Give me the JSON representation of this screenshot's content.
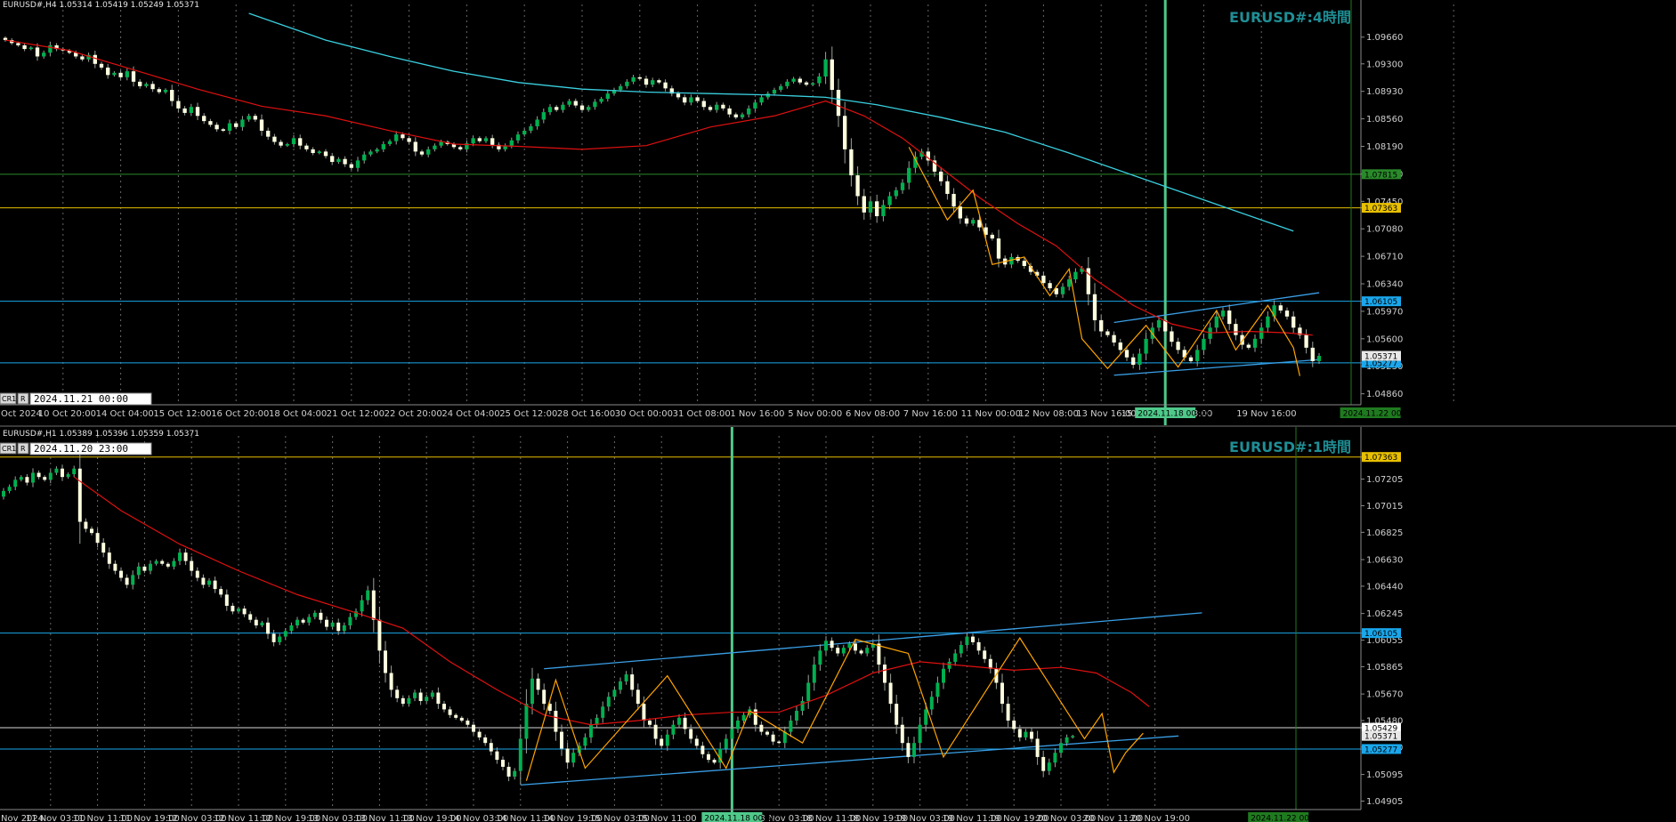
{
  "colors": {
    "bg": "#000000",
    "bull": "#00b050",
    "bear": "#ffffe0",
    "wick": "#9aa39a",
    "ma_fast": "#e01010",
    "ma_slow": "#3ad0e0",
    "zigzag": "#ffa500",
    "channel": "#3aa0e8",
    "hline_blue": "#1aa7ec",
    "hline_yellow": "#e8c000",
    "hline_green": "#2a8a2a",
    "hline_white": "#d8d8d8",
    "vline_green": "#4fc98a",
    "grid": "#bdbdbd",
    "watermark": "#1f8f96"
  },
  "chart_data": [
    {
      "type": "candlestick",
      "symbol_info": "EURUSD#,H4  1.05314 1.05419 1.05249 1.05371",
      "watermark": "EURUSD#:4時間",
      "cursor_date": "2024.11.21 00:00",
      "cursor_btn_cr": "CR1",
      "cursor_btn_r": "R",
      "ylim": [
        1.0476,
        1.0998
      ],
      "price_ticks": [
        "1.09660",
        "1.09300",
        "1.08930",
        "1.08560",
        "1.08190",
        "1.07820",
        "1.07450",
        "1.07080",
        "1.06710",
        "1.06340",
        "1.05970",
        "1.05600",
        "1.05230",
        "1.04860"
      ],
      "price_tick_values": [
        1.0966,
        1.093,
        1.0893,
        1.0856,
        1.0819,
        1.0782,
        1.0745,
        1.0708,
        1.0671,
        1.0634,
        1.0597,
        1.056,
        1.0523,
        1.0486
      ],
      "time_labels": [
        "Oct 2024",
        "10 Oct 20:00",
        "14 Oct 04:00",
        "15 Oct 12:00",
        "16 Oct 20:00",
        "18 Oct 04:00",
        "21 Oct 12:00",
        "22 Oct 20:00",
        "24 Oct 04:00",
        "25 Oct 12:00",
        "28 Oct 16:00",
        "30 Oct 00:00",
        "31 Oct 08:00",
        "1 Nov 16:00",
        "5 Nov 00:00",
        "6 Nov 08:00",
        "7 Nov 16:00",
        "11 Nov 00:00",
        "12 Nov 08:00",
        "13 Nov 16:00",
        "15",
        "v 08:00",
        "19 Nov 16:00"
      ],
      "time_label_bars": [
        0,
        9,
        18,
        27,
        36,
        45,
        54,
        63,
        72,
        81,
        90,
        99,
        108,
        117,
        126,
        135,
        144,
        153,
        162,
        171,
        178,
        187,
        196
      ],
      "time_marker_label": "2024.11.18 00:00",
      "time_marker_label_bar": 181,
      "future_time_label": "2024.11.22 00:00",
      "future_time_label_bar": 213,
      "hlines": [
        {
          "price": 1.07815,
          "label": "1.07815",
          "color": "hline_green"
        },
        {
          "price": 1.07363,
          "label": "1.07363",
          "color": "hline_yellow"
        },
        {
          "price": 1.06105,
          "label": "1.06105",
          "color": "hline_blue"
        },
        {
          "price": 1.05277,
          "label": "1.05277",
          "color": "hline_blue"
        }
      ],
      "current_price": 1.05371,
      "current_price_label": "1.05371",
      "vline_bar": 181,
      "future_vline_bar": 210,
      "channel_upper": [
        [
          173,
          1.0582
        ],
        [
          205,
          1.0622
        ]
      ],
      "channel_lower": [
        [
          173,
          1.0511
        ],
        [
          205,
          1.0532
        ]
      ],
      "ma_fast_points": [
        [
          0,
          1.0962
        ],
        [
          10,
          1.0948
        ],
        [
          20,
          1.0922
        ],
        [
          30,
          1.0896
        ],
        [
          40,
          1.0873
        ],
        [
          50,
          1.086
        ],
        [
          60,
          1.084
        ],
        [
          70,
          1.0822
        ],
        [
          80,
          1.0819
        ],
        [
          90,
          1.0815
        ],
        [
          100,
          1.082
        ],
        [
          110,
          1.0845
        ],
        [
          120,
          1.086
        ],
        [
          128,
          1.088
        ],
        [
          134,
          1.086
        ],
        [
          140,
          1.083
        ],
        [
          146,
          1.079
        ],
        [
          152,
          1.075
        ],
        [
          158,
          1.0715
        ],
        [
          164,
          1.0685
        ],
        [
          170,
          1.064
        ],
        [
          176,
          1.0605
        ],
        [
          182,
          1.058
        ],
        [
          188,
          1.0568
        ],
        [
          194,
          1.057
        ],
        [
          200,
          1.0568
        ],
        [
          204,
          1.0565
        ]
      ],
      "ma_slow_points": [
        [
          38,
          1.0998
        ],
        [
          50,
          1.0962
        ],
        [
          60,
          1.094
        ],
        [
          70,
          1.092
        ],
        [
          80,
          1.0905
        ],
        [
          90,
          1.0896
        ],
        [
          100,
          1.0892
        ],
        [
          110,
          1.089
        ],
        [
          120,
          1.0888
        ],
        [
          128,
          1.0885
        ],
        [
          136,
          1.0875
        ],
        [
          146,
          1.0858
        ],
        [
          156,
          1.0838
        ],
        [
          166,
          1.081
        ],
        [
          176,
          1.078
        ],
        [
          186,
          1.075
        ],
        [
          196,
          1.072
        ],
        [
          201,
          1.0705
        ]
      ],
      "zigzag_points": [
        [
          141,
          1.0818
        ],
        [
          147,
          1.072
        ],
        [
          151,
          1.076
        ],
        [
          154,
          1.066
        ],
        [
          159,
          1.067
        ],
        [
          163,
          1.0618
        ],
        [
          166,
          1.0654
        ],
        [
          168,
          1.056
        ],
        [
          172,
          1.052
        ],
        [
          178,
          1.0578
        ],
        [
          183,
          1.0522
        ],
        [
          189,
          1.0598
        ],
        [
          192,
          1.0545
        ],
        [
          197,
          1.0605
        ],
        [
          201,
          1.0548
        ],
        [
          202,
          1.051
        ]
      ],
      "candles": {
        "start_bar": 0,
        "start_price": 1.0965,
        "closes": [
          1.0962,
          1.0958,
          1.0955,
          1.095,
          1.0952,
          1.094,
          1.0945,
          1.0955,
          1.095,
          1.0948,
          1.0945,
          1.094,
          1.0936,
          1.0942,
          1.093,
          1.0925,
          1.0915,
          1.0918,
          1.0912,
          1.092,
          1.0906,
          1.09,
          1.0903,
          1.0896,
          1.0892,
          1.0895,
          1.088,
          1.087,
          1.0864,
          1.0872,
          1.086,
          1.0853,
          1.0848,
          1.0842,
          1.084,
          1.085,
          1.0845,
          1.0855,
          1.086,
          1.0855,
          1.084,
          1.0832,
          1.0825,
          1.082,
          1.0822,
          1.083,
          1.082,
          1.0815,
          1.081,
          1.0812,
          1.0806,
          1.0798,
          1.0802,
          1.0795,
          1.079,
          1.08,
          1.0808,
          1.0812,
          1.0815,
          1.0822,
          1.0826,
          1.0835,
          1.083,
          1.0825,
          1.0812,
          1.0808,
          1.0815,
          1.082,
          1.0825,
          1.0822,
          1.0818,
          1.0815,
          1.0823,
          1.083,
          1.0826,
          1.083,
          1.0821,
          1.0815,
          1.082,
          1.0827,
          1.0835,
          1.084,
          1.0846,
          1.0855,
          1.0865,
          1.0872,
          1.0868,
          1.0875,
          1.088,
          1.0874,
          1.0868,
          1.0872,
          1.0879,
          1.0883,
          1.089,
          1.0895,
          1.09,
          1.0906,
          1.0912,
          1.091,
          1.0902,
          1.0908,
          1.0905,
          1.0897,
          1.089,
          1.0885,
          1.0878,
          1.0885,
          1.088,
          1.0872,
          1.0868,
          1.0875,
          1.087,
          1.0862,
          1.0858,
          1.0862,
          1.087,
          1.0878,
          1.0885,
          1.089,
          1.0895,
          1.09,
          1.0906,
          1.091,
          1.0905,
          1.0902,
          1.0904,
          1.0913,
          1.0936,
          1.0895,
          1.086,
          1.0815,
          1.078,
          1.0752,
          1.073,
          1.0745,
          1.0725,
          1.074,
          1.0752,
          1.076,
          1.077,
          1.079,
          1.0805,
          1.0812,
          1.08,
          1.0785,
          1.0772,
          1.0755,
          1.0738,
          1.0722,
          1.0715,
          1.072,
          1.071,
          1.07,
          1.0695,
          1.0668,
          1.066,
          1.067,
          1.0665,
          1.0658,
          1.065,
          1.0645,
          1.0635,
          1.0628,
          1.062,
          1.063,
          1.064,
          1.065,
          1.0655,
          1.062,
          1.0585,
          1.057,
          1.0565,
          1.0555,
          1.0545,
          1.0535,
          1.0525,
          1.054,
          1.056,
          1.0575,
          1.0585,
          1.057,
          1.0556,
          1.0545,
          1.0535,
          1.053,
          1.0545,
          1.056,
          1.0575,
          1.059,
          1.0598,
          1.058,
          1.0565,
          1.0552,
          1.0548,
          1.056,
          1.0575,
          1.059,
          1.0605,
          1.0598,
          1.059,
          1.0575,
          1.0565,
          1.0548,
          1.053,
          1.0537
        ]
      }
    },
    {
      "type": "candlestick",
      "symbol_info": "EURUSD#,H1  1.05389 1.05396 1.05359 1.05371",
      "watermark": "EURUSD#:1時間",
      "cursor_date": "2024.11.20 23:00",
      "cursor_btn_cr": "CR1",
      "cursor_btn_r": "R",
      "ylim": [
        1.0487,
        1.0745
      ],
      "price_ticks": [
        "1.07205",
        "1.07015",
        "1.06825",
        "1.06630",
        "1.06440",
        "1.06245",
        "1.06055",
        "1.05865",
        "1.05670",
        "1.05480",
        "1.05290",
        "1.05095",
        "1.04905"
      ],
      "price_tick_values": [
        1.07205,
        1.07015,
        1.06825,
        1.0663,
        1.0644,
        1.06245,
        1.06055,
        1.05865,
        1.0567,
        1.0548,
        1.0529,
        1.05095,
        1.04905
      ],
      "time_labels": [
        "Nov 2024",
        "11 Nov 03:00",
        "11 Nov 11:00",
        "11 Nov 19:00",
        "12 Nov 03:00",
        "12 Nov 11:00",
        "12 Nov 19:00",
        "13 Nov 03:00",
        "13 Nov 11:00",
        "13 Nov 19:00",
        "14 Nov 03:00",
        "14 Nov 11:00",
        "14 Nov 19:00",
        "15 Nov 03:00",
        "15 Nov 11:00",
        "00:00",
        "18 Nov 03:00",
        "18 Nov 11:00",
        "18 Nov 19:00",
        "19 Nov 03:00",
        "19 Nov 11:00",
        "19 Nov 19:00",
        "20 Nov 03:00",
        "20 Nov 11:00",
        "20 Nov 19:00"
      ],
      "time_label_bars": [
        0,
        8,
        16,
        24,
        32,
        40,
        48,
        56,
        64,
        72,
        80,
        88,
        96,
        104,
        112,
        124,
        132,
        140,
        148,
        156,
        164,
        172,
        180,
        188,
        196
      ],
      "time_marker_label": "2024.11.18 00:00",
      "time_marker_label_bar": 124,
      "future_time_label": "2024.11.22 00:00",
      "future_time_label_bar": 217,
      "hlines": [
        {
          "price": 1.07363,
          "label": "1.07363",
          "color": "hline_yellow"
        },
        {
          "price": 1.06105,
          "label": "1.06105",
          "color": "hline_blue"
        },
        {
          "price": 1.05429,
          "label": "1.05429",
          "color": "hline_white"
        },
        {
          "price": 1.05277,
          "label": "1.05277",
          "color": "hline_blue"
        }
      ],
      "current_price": 1.05371,
      "current_price_label": "1.05371",
      "vline_bar": 124,
      "future_vline_bar": 220,
      "channel_upper": [
        [
          92,
          1.0585
        ],
        [
          204,
          1.0625
        ]
      ],
      "channel_lower": [
        [
          88,
          1.0502
        ],
        [
          200,
          1.0537
        ]
      ],
      "ma_fast_points": [
        [
          12,
          1.0722
        ],
        [
          20,
          1.0698
        ],
        [
          30,
          1.0674
        ],
        [
          40,
          1.0655
        ],
        [
          50,
          1.0638
        ],
        [
          60,
          1.0625
        ],
        [
          68,
          1.0614
        ],
        [
          76,
          1.059
        ],
        [
          84,
          1.057
        ],
        [
          92,
          1.0552
        ],
        [
          100,
          1.0545
        ],
        [
          108,
          1.0548
        ],
        [
          116,
          1.0552
        ],
        [
          124,
          1.0554
        ],
        [
          132,
          1.0554
        ],
        [
          140,
          1.0566
        ],
        [
          148,
          1.0582
        ],
        [
          156,
          1.059
        ],
        [
          164,
          1.0587
        ],
        [
          172,
          1.0584
        ],
        [
          180,
          1.0586
        ],
        [
          186,
          1.0582
        ],
        [
          192,
          1.0568
        ],
        [
          195,
          1.0558
        ]
      ],
      "zigzag_points": [
        [
          89,
          1.0505
        ],
        [
          94,
          1.0577
        ],
        [
          99,
          1.0514
        ],
        [
          113,
          1.058
        ],
        [
          123,
          1.0514
        ],
        [
          127,
          1.0555
        ],
        [
          136,
          1.0532
        ],
        [
          145,
          1.0606
        ],
        [
          154,
          1.0596
        ],
        [
          160,
          1.0522
        ],
        [
          173,
          1.0607
        ],
        [
          184,
          1.0535
        ],
        [
          187,
          1.0553
        ],
        [
          189,
          1.0511
        ],
        [
          191,
          1.0525
        ],
        [
          194,
          1.0539
        ]
      ],
      "candles": {
        "start_bar": 0,
        "start_price": 1.0708,
        "closes": [
          1.0712,
          1.0715,
          1.072,
          1.0722,
          1.0718,
          1.0725,
          1.0722,
          1.072,
          1.0725,
          1.0728,
          1.0722,
          1.0724,
          1.0728,
          1.069,
          1.0685,
          1.0682,
          1.0675,
          1.0668,
          1.066,
          1.0655,
          1.065,
          1.0645,
          1.0652,
          1.0658,
          1.0655,
          1.066,
          1.0662,
          1.066,
          1.0658,
          1.0662,
          1.0668,
          1.0662,
          1.0655,
          1.065,
          1.0645,
          1.0648,
          1.0642,
          1.0638,
          1.063,
          1.0626,
          1.0628,
          1.0624,
          1.062,
          1.0616,
          1.0618,
          1.061,
          1.0604,
          1.0608,
          1.0612,
          1.0616,
          1.062,
          1.0618,
          1.0622,
          1.0625,
          1.062,
          1.0615,
          1.0618,
          1.0612,
          1.0616,
          1.0622,
          1.0626,
          1.0634,
          1.0641,
          1.062,
          1.0598,
          1.0582,
          1.057,
          1.0564,
          1.056,
          1.0564,
          1.0568,
          1.0562,
          1.0565,
          1.0568,
          1.056,
          1.0556,
          1.0552,
          1.055,
          1.0548,
          1.0545,
          1.054,
          1.0536,
          1.0532,
          1.0526,
          1.052,
          1.0515,
          1.0508,
          1.0512,
          1.0535,
          1.056,
          1.0578,
          1.057,
          1.056,
          1.0555,
          1.054,
          1.0528,
          1.0518,
          1.0525,
          1.053,
          1.0536,
          1.0545,
          1.055,
          1.0558,
          1.0565,
          1.057,
          1.0576,
          1.0581,
          1.057,
          1.056,
          1.0548,
          1.0545,
          1.0535,
          1.053,
          1.0538,
          1.0545,
          1.055,
          1.0542,
          1.0535,
          1.053,
          1.0524,
          1.052,
          1.0518,
          1.0528,
          1.0535,
          1.0542,
          1.0548,
          1.0552,
          1.0556,
          1.0545,
          1.054,
          1.0538,
          1.0533,
          1.0532,
          1.054,
          1.0548,
          1.0555,
          1.0562,
          1.0575,
          1.0588,
          1.0598,
          1.0605,
          1.06,
          1.0596,
          1.06,
          1.0603,
          1.0598,
          1.0596,
          1.06,
          1.0603,
          1.0588,
          1.0575,
          1.056,
          1.0545,
          1.0532,
          1.0522,
          1.0532,
          1.0545,
          1.0556,
          1.0565,
          1.0575,
          1.0585,
          1.059,
          1.0596,
          1.0602,
          1.0608,
          1.0604,
          1.0598,
          1.0592,
          1.0585,
          1.0575,
          1.056,
          1.0548,
          1.0542,
          1.0536,
          1.054,
          1.0535,
          1.0522,
          1.0512,
          1.0518,
          1.0525,
          1.0532,
          1.0536,
          1.0537
        ]
      }
    }
  ]
}
